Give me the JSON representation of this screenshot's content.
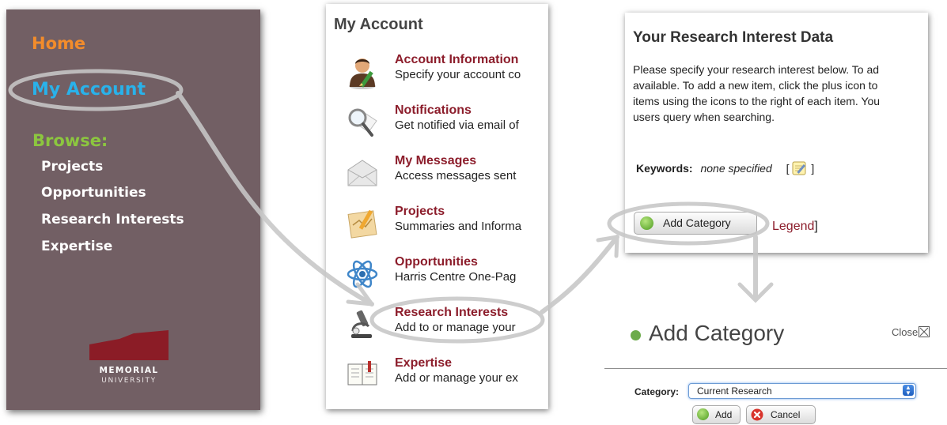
{
  "sidebar": {
    "home": "Home",
    "my_account": "My Account",
    "browse": "Browse:",
    "items": [
      "Projects",
      "Opportunities",
      "Research Interests",
      "Expertise"
    ],
    "logo_line1": "MEMORIAL",
    "logo_line2": "UNIVERSITY",
    "colors": {
      "background": "#725f64",
      "home": "#f28c2b",
      "my_account": "#29b2ea",
      "browse": "#8cc63f"
    }
  },
  "account": {
    "title": "My Account",
    "items": [
      {
        "title": "Account Information",
        "desc": "Specify your account co",
        "icon": "user-pencil-icon"
      },
      {
        "title": "Notifications",
        "desc": "Get notified via email of",
        "icon": "magnifier-icon"
      },
      {
        "title": "My Messages",
        "desc": "Access messages sent",
        "icon": "envelope-icon"
      },
      {
        "title": "Projects",
        "desc": "Summaries and Informa",
        "icon": "map-pencil-icon"
      },
      {
        "title": "Opportunities",
        "desc": "Harris Centre One-Pag",
        "icon": "atom-icon"
      },
      {
        "title": "Research Interests",
        "desc": "Add to or manage your",
        "icon": "microscope-icon"
      },
      {
        "title": "Expertise",
        "desc": "Add or manage your ex",
        "icon": "book-icon"
      }
    ],
    "link_color": "#8c1d2b"
  },
  "research": {
    "title": "Your Research Interest Data",
    "intro_lines": [
      "Please specify your research interest below. To ad",
      "available. To add a new item, click the plus icon to",
      "items using the icons to the right of each item. You",
      "users query when searching."
    ],
    "keywords_label": "Keywords:",
    "keywords_value": "none specified",
    "bracket_open": "[",
    "bracket_close": "]",
    "add_category_button": "Add Category",
    "legend_link": "Legend",
    "legend_close": "]"
  },
  "add_category": {
    "title": "Add Category",
    "close": "Close",
    "category_label": "Category:",
    "category_value": "Current Research",
    "add_button": "Add",
    "cancel_button": "Cancel"
  }
}
